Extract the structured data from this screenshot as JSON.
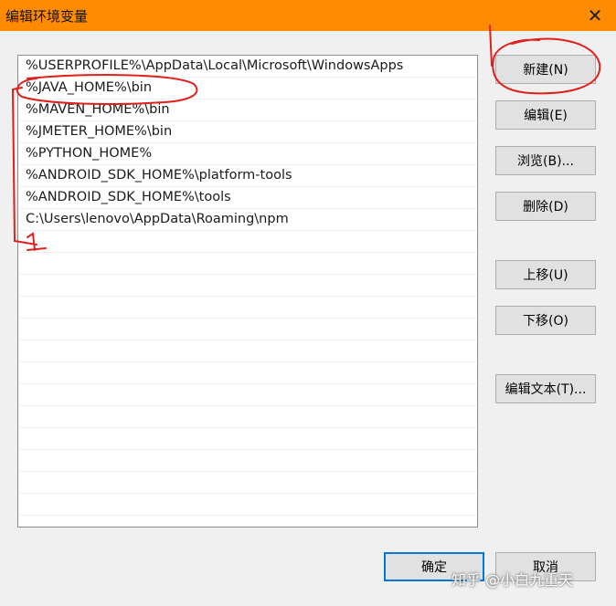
{
  "window": {
    "title": "编辑环境变量",
    "close_glyph": "✕"
  },
  "list": {
    "items": [
      "%USERPROFILE%\\AppData\\Local\\Microsoft\\WindowsApps",
      "%JAVA_HOME%\\bin",
      "%MAVEN_HOME%\\bin",
      "%JMETER_HOME%\\bin",
      "%PYTHON_HOME%",
      "%ANDROID_SDK_HOME%\\platform-tools",
      "%ANDROID_SDK_HOME%\\tools",
      "C:\\Users\\lenovo\\AppData\\Roaming\\npm",
      "",
      "",
      "",
      "",
      "",
      "",
      "",
      "",
      "",
      "",
      "",
      "",
      ""
    ]
  },
  "buttons": {
    "new": "新建(N)",
    "edit": "编辑(E)",
    "browse": "浏览(B)...",
    "delete": "删除(D)",
    "move_up": "上移(U)",
    "move_down": "下移(O)",
    "edit_text": "编辑文本(T)...",
    "ok": "确定",
    "cancel": "取消"
  },
  "watermark": "知乎 @小白九重天",
  "annotation_color": "#e0201c"
}
